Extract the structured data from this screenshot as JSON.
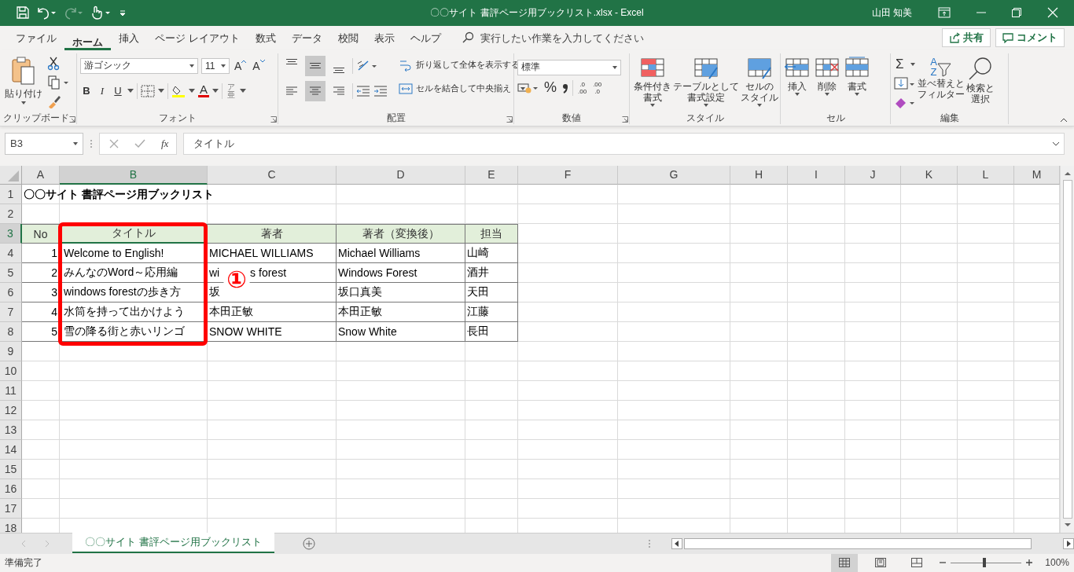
{
  "title_bar": {
    "quick_access": [
      {
        "kind": "save",
        "disabled": false
      },
      {
        "kind": "undo",
        "disabled": false
      },
      {
        "kind": "redo",
        "disabled": true
      },
      {
        "kind": "touch",
        "disabled": false
      },
      {
        "kind": "customize",
        "disabled": false
      }
    ],
    "title": "〇〇サイト 書評ページ用ブックリスト.xlsx  -  Excel",
    "user": "山田 知美"
  },
  "menu_tabs": [
    {
      "label": "ファイル",
      "selected": false
    },
    {
      "label": "ホーム",
      "selected": true
    },
    {
      "label": "挿入",
      "selected": false
    },
    {
      "label": "ページ レイアウト",
      "selected": false
    },
    {
      "label": "数式",
      "selected": false
    },
    {
      "label": "データ",
      "selected": false
    },
    {
      "label": "校閲",
      "selected": false
    },
    {
      "label": "表示",
      "selected": false
    },
    {
      "label": "ヘルプ",
      "selected": false
    }
  ],
  "search": {
    "placeholder": "実行したい作業を入力してください"
  },
  "share": "共有",
  "comment": "コメント",
  "ribbon": [
    {
      "kind": "clipboard",
      "label": "クリップボード",
      "paste": "貼り付け"
    },
    {
      "kind": "font",
      "label": "フォント",
      "font_name": "游ゴシック",
      "font_size": "11",
      "grow": "A",
      "shrink": "A",
      "styles": [
        "B",
        "I",
        "U"
      ],
      "font_color": "A",
      "phonetic": [
        "ア",
        "亜"
      ]
    },
    {
      "kind": "alignment",
      "label": "配置",
      "vertical": [
        {
          "selected": false
        },
        {
          "selected": true
        },
        {
          "selected": false
        }
      ],
      "horizontal": [
        {
          "selected": false
        },
        {
          "selected": true
        },
        {
          "selected": false
        }
      ],
      "wrap": "折り返して全体を表示する",
      "merge": "セルを結合して中央揃え"
    },
    {
      "kind": "number",
      "label": "数値",
      "format": "標準",
      "percent": "%",
      "decimals": [
        [
          ".0",
          ".00"
        ],
        [
          ".00",
          ".0"
        ]
      ]
    },
    {
      "kind": "buttons",
      "label": "スタイル",
      "buttons": [
        {
          "kind": "conditional",
          "lines": [
            "条件付き",
            "書式"
          ]
        },
        {
          "kind": "table",
          "lines": [
            "テーブルとして",
            "書式設定"
          ]
        },
        {
          "kind": "cellstyle",
          "lines": [
            "セルの",
            "スタイル"
          ]
        }
      ]
    },
    {
      "kind": "buttons",
      "label": "セル",
      "buttons": [
        {
          "kind": "insert",
          "lines": [
            "挿入"
          ]
        },
        {
          "kind": "delete",
          "lines": [
            "削除"
          ]
        },
        {
          "kind": "format",
          "lines": [
            "書式"
          ]
        }
      ]
    },
    {
      "kind": "editing",
      "label": "編集",
      "sum": "Σ",
      "sort": [
        "A",
        "Z"
      ],
      "sort_lines": [
        "並べ替えと",
        "フィルター"
      ],
      "find_lines": [
        "検索と",
        "選択"
      ]
    }
  ],
  "formula_bar": {
    "name_box": "B3",
    "fx": "fx",
    "formula": "タイトル"
  },
  "columns": [
    {
      "label": "A",
      "selected": false
    },
    {
      "label": "B",
      "selected": true
    },
    {
      "label": "C",
      "selected": false
    },
    {
      "label": "D",
      "selected": false
    },
    {
      "label": "E",
      "selected": false
    },
    {
      "label": "F",
      "selected": false
    },
    {
      "label": "G",
      "selected": false
    },
    {
      "label": "H",
      "selected": false
    },
    {
      "label": "I",
      "selected": false
    },
    {
      "label": "J",
      "selected": false
    },
    {
      "label": "K",
      "selected": false
    },
    {
      "label": "L",
      "selected": false
    },
    {
      "label": "M",
      "selected": false
    }
  ],
  "rows": [
    {
      "number": "1",
      "selected": false,
      "kind": "title",
      "cells": [
        "〇〇サイト 書評ページ用ブックリスト"
      ]
    },
    {
      "number": "2",
      "selected": false,
      "kind": "empty"
    },
    {
      "number": "3",
      "selected": true,
      "kind": "header",
      "cells": [
        "No",
        "タイトル",
        "著者",
        "著者（変換後）",
        "担当"
      ]
    },
    {
      "number": "4",
      "selected": false,
      "kind": "data",
      "cells": [
        "1",
        "Welcome to English!",
        "MICHAEL WILLIAMS",
        "Michael Williams",
        "山崎"
      ]
    },
    {
      "number": "5",
      "selected": false,
      "kind": "data",
      "cells": [
        "2",
        "みんなのWord～応用編",
        "wi          s forest",
        "Windows Forest",
        "酒井"
      ]
    },
    {
      "number": "6",
      "selected": false,
      "kind": "data",
      "cells": [
        "3",
        "windows forestの歩き方",
        "坂",
        "坂口真美",
        "天田"
      ]
    },
    {
      "number": "7",
      "selected": false,
      "kind": "data",
      "cells": [
        "4",
        "水筒を持って出かけよう",
        "本田正敏",
        "本田正敏",
        "江藤"
      ]
    },
    {
      "number": "8",
      "selected": false,
      "kind": "data",
      "cells": [
        "5",
        "雪の降る街と赤いリンゴ",
        "SNOW WHITE",
        "Snow White",
        "長田"
      ]
    },
    {
      "number": "9",
      "selected": false,
      "kind": "empty"
    },
    {
      "number": "10",
      "selected": false,
      "kind": "empty"
    },
    {
      "number": "11",
      "selected": false,
      "kind": "empty"
    },
    {
      "number": "12",
      "selected": false,
      "kind": "empty"
    },
    {
      "number": "13",
      "selected": false,
      "kind": "empty"
    },
    {
      "number": "14",
      "selected": false,
      "kind": "empty"
    },
    {
      "number": "15",
      "selected": false,
      "kind": "empty"
    },
    {
      "number": "16",
      "selected": false,
      "kind": "empty"
    },
    {
      "number": "17",
      "selected": false,
      "kind": "empty"
    },
    {
      "number": "18",
      "selected": false,
      "kind": "empty"
    }
  ],
  "callout": {
    "marker": "①"
  },
  "sheet_tabs": [
    {
      "label": "〇〇サイト 書評ページ用ブックリスト",
      "selected": true
    }
  ],
  "status_bar": {
    "status": "準備完了",
    "views": [
      {
        "kind": "normal",
        "selected": true
      },
      {
        "kind": "layout",
        "selected": false
      },
      {
        "kind": "pagebreak",
        "selected": false
      }
    ],
    "zoom": {
      "level": 0.47,
      "reading": "100%"
    }
  }
}
